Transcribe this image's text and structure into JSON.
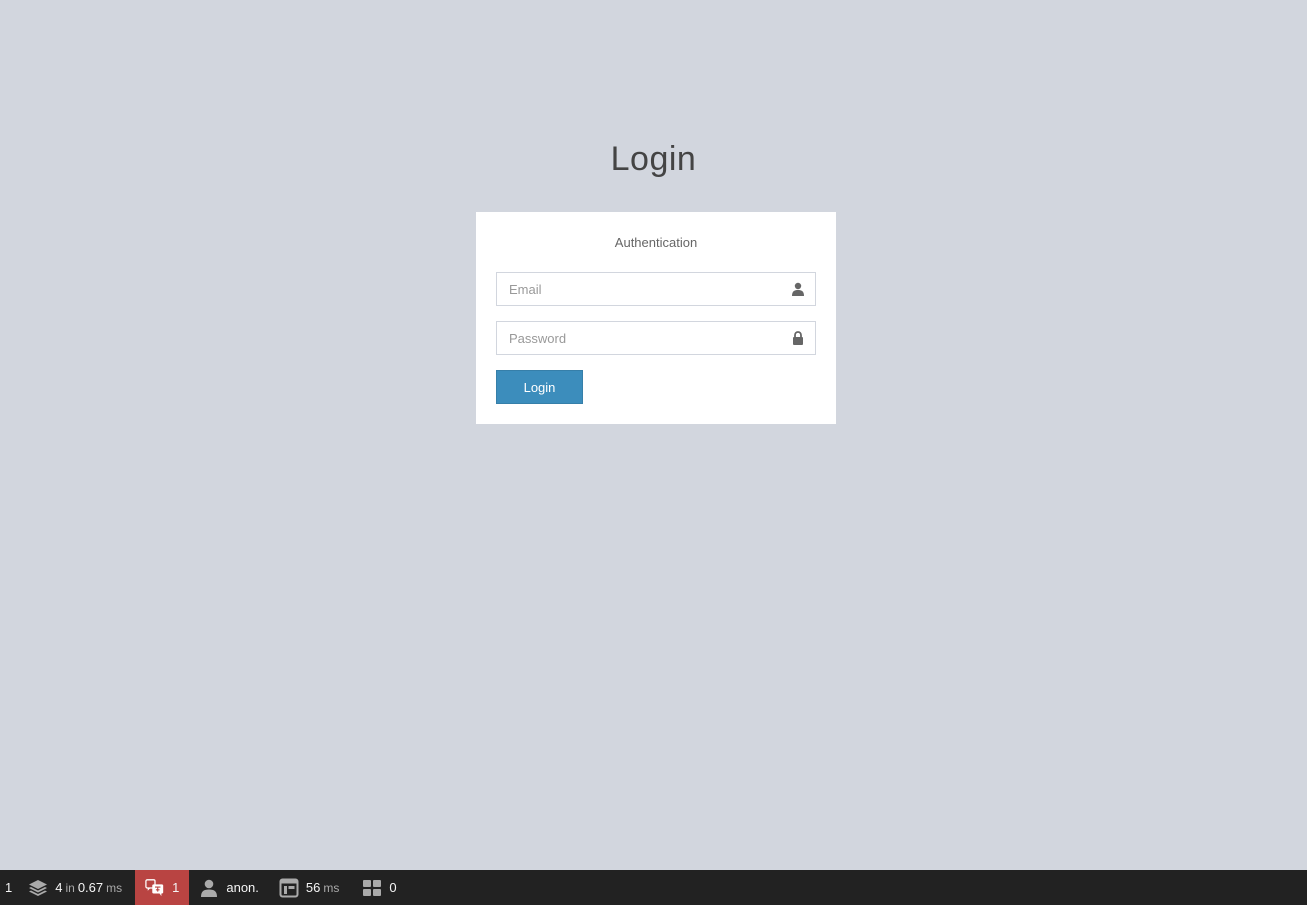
{
  "page": {
    "title": "Login"
  },
  "login_box": {
    "message": "Authentication",
    "email": {
      "placeholder": "Email",
      "value": "",
      "icon": "user-icon"
    },
    "password": {
      "placeholder": "Password",
      "value": "",
      "icon": "lock-icon"
    },
    "submit_label": "Login"
  },
  "debug_toolbar": {
    "status": "1",
    "database": {
      "queries": "4",
      "in_label": "in",
      "time": "0.67",
      "unit": "ms",
      "icon": "layers-icon"
    },
    "translation": {
      "count": "1",
      "icon": "translation-icon",
      "color": "#b94442"
    },
    "user": {
      "name": "anon.",
      "icon": "user-icon"
    },
    "timing": {
      "value": "56",
      "unit": "ms",
      "icon": "window-icon"
    },
    "forms": {
      "count": "0",
      "icon": "grid-icon"
    }
  },
  "colors": {
    "background": "#d2d6de",
    "primary_button": "#3c8dbc",
    "toolbar": "#222222"
  }
}
